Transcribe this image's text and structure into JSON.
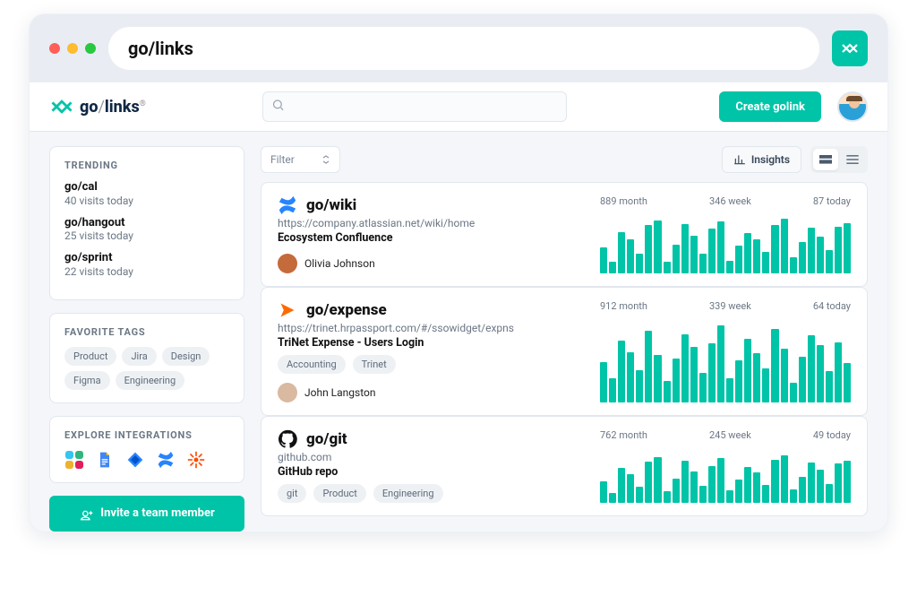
{
  "chrome": {
    "url_text": "go/links"
  },
  "header": {
    "logo_pre": "go",
    "logo_slash": "/",
    "logo_post": "links",
    "logo_reg": "®",
    "search_placeholder": "",
    "create_btn": "Create golink"
  },
  "sidebar": {
    "trending_title": "TRENDING",
    "trending": [
      {
        "title": "go/cal",
        "sub": "40 visits today"
      },
      {
        "title": "go/hangout",
        "sub": "25 visits today"
      },
      {
        "title": "go/sprint",
        "sub": "22 visits today"
      }
    ],
    "tags_title": "FAVORITE TAGS",
    "tags": [
      "Product",
      "Jira",
      "Design",
      "Figma",
      "Engineering"
    ],
    "integrations_title": "EXPLORE INTEGRATIONS",
    "integration_icons": [
      "slack-icon",
      "google-docs-icon",
      "jira-icon",
      "confluence-icon",
      "zapier-icon"
    ],
    "invite_btn": "Invite a team member"
  },
  "toolbar": {
    "filter": "Filter",
    "insights": "Insights"
  },
  "links": [
    {
      "icon": "confluence-icon",
      "title": "go/wiki",
      "url": "https://company.atlassian.net/wiki/home",
      "desc": "Ecosystem Confluence",
      "tags": [],
      "owner": "Olivia Johnson",
      "owner_color": "#c56a3a",
      "stats": {
        "month": "889 month",
        "week": "346 week",
        "today": "87 today"
      },
      "bars": [
        45,
        20,
        72,
        60,
        35,
        84,
        92,
        20,
        50,
        86,
        65,
        34,
        78,
        90,
        22,
        48,
        70,
        60,
        38,
        85,
        95,
        28,
        54,
        80,
        64,
        40,
        82,
        88
      ]
    },
    {
      "icon": "expense-icon",
      "title": "go/expense",
      "url": "https://trinet.hrpassport.com/#/ssowidget/expns",
      "desc": "TriNet Expense - Users Login",
      "tags": [
        "Accounting",
        "Trinet"
      ],
      "owner": "John Langston",
      "owner_color": "#d9b9a0",
      "stats": {
        "month": "912 month",
        "week": "339 week",
        "today": "64 today"
      },
      "bars": [
        50,
        30,
        76,
        62,
        40,
        88,
        58,
        26,
        54,
        84,
        68,
        36,
        72,
        94,
        30,
        52,
        78,
        60,
        42,
        90,
        66,
        24,
        56,
        82,
        70,
        38,
        74,
        48
      ]
    },
    {
      "icon": "github-icon",
      "title": "go/git",
      "url": "github.com",
      "desc": "GitHub repo",
      "tags": [
        "git",
        "Product",
        "Engineering"
      ],
      "owner": "",
      "owner_color": "",
      "stats": {
        "month": "762 month",
        "week": "245 week",
        "today": "49 today"
      },
      "bars": [
        40,
        18,
        66,
        54,
        30,
        78,
        86,
        22,
        46,
        80,
        60,
        32,
        70,
        84,
        24,
        44,
        68,
        58,
        34,
        82,
        90,
        26,
        50,
        76,
        62,
        36,
        74,
        80
      ]
    }
  ],
  "chart_data": [
    {
      "type": "bar",
      "title": "go/wiki usage",
      "categories_count": 28,
      "values": [
        45,
        20,
        72,
        60,
        35,
        84,
        92,
        20,
        50,
        86,
        65,
        34,
        78,
        90,
        22,
        48,
        70,
        60,
        38,
        85,
        95,
        28,
        54,
        80,
        64,
        40,
        82,
        88
      ],
      "ylim": [
        0,
        100
      ],
      "summary": {
        "month": 889,
        "week": 346,
        "today": 87
      }
    },
    {
      "type": "bar",
      "title": "go/expense usage",
      "categories_count": 28,
      "values": [
        50,
        30,
        76,
        62,
        40,
        88,
        58,
        26,
        54,
        84,
        68,
        36,
        72,
        94,
        30,
        52,
        78,
        60,
        42,
        90,
        66,
        24,
        56,
        82,
        70,
        38,
        74,
        48
      ],
      "ylim": [
        0,
        100
      ],
      "summary": {
        "month": 912,
        "week": 339,
        "today": 64
      }
    },
    {
      "type": "bar",
      "title": "go/git usage",
      "categories_count": 28,
      "values": [
        40,
        18,
        66,
        54,
        30,
        78,
        86,
        22,
        46,
        80,
        60,
        32,
        70,
        84,
        24,
        44,
        68,
        58,
        34,
        82,
        90,
        26,
        50,
        76,
        62,
        36,
        74,
        80
      ],
      "ylim": [
        0,
        100
      ],
      "summary": {
        "month": 762,
        "week": 245,
        "today": 49
      }
    }
  ]
}
